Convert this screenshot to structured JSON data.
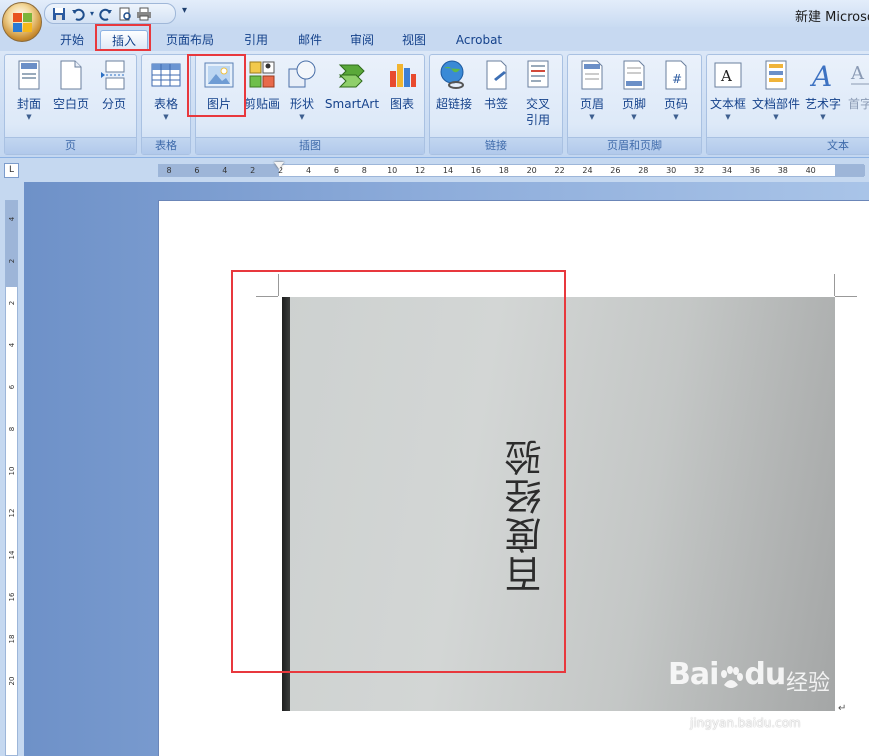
{
  "window": {
    "title": "新建 Microso"
  },
  "qat": {
    "icons": [
      "save-icon",
      "undo-icon",
      "redo-icon",
      "print-preview-icon",
      "quick-print-icon"
    ],
    "more": "▾"
  },
  "tabs": [
    {
      "label": "开始"
    },
    {
      "label": "插入",
      "active": true
    },
    {
      "label": "页面布局"
    },
    {
      "label": "引用"
    },
    {
      "label": "邮件"
    },
    {
      "label": "审阅"
    },
    {
      "label": "视图"
    },
    {
      "label": "Acrobat"
    }
  ],
  "ribbon": {
    "groups": [
      {
        "label": "页",
        "buttons": [
          "封面",
          "空白页",
          "分页"
        ]
      },
      {
        "label": "表格",
        "buttons": [
          "表格"
        ]
      },
      {
        "label": "插图",
        "buttons": [
          "图片",
          "剪贴画",
          "形状",
          "SmartArt",
          "图表"
        ]
      },
      {
        "label": "链接",
        "buttons": [
          "超链接",
          "书签",
          "交叉",
          "引用"
        ]
      },
      {
        "label": "页眉和页脚",
        "buttons": [
          "页眉",
          "页脚",
          "页码"
        ]
      },
      {
        "label": "文本",
        "buttons": [
          "文本框",
          "文档部件",
          "艺术字",
          "首字"
        ]
      }
    ]
  },
  "ruler": {
    "corner": "L",
    "horizontal_ticks": [
      "8",
      "6",
      "4",
      "2",
      "2",
      "4",
      "6",
      "8",
      "10",
      "12",
      "14",
      "16",
      "18",
      "20",
      "22",
      "24",
      "26",
      "28",
      "30",
      "32",
      "34",
      "36",
      "38",
      "40"
    ],
    "vertical_ticks": [
      "4",
      "2",
      "2",
      "4",
      "6",
      "8",
      "10",
      "12",
      "14",
      "16",
      "18",
      "20"
    ]
  },
  "document": {
    "photo_text": "百度经验",
    "return_mark": "↵"
  },
  "watermark": {
    "brand": "Bai",
    "brand_tail": "du",
    "cn": "经验",
    "url": "jingyan.baidu.com"
  },
  "colors": {
    "highlight": "#e8383d",
    "ribbon": "#dbe7f7",
    "tab_text": "#15428b"
  }
}
